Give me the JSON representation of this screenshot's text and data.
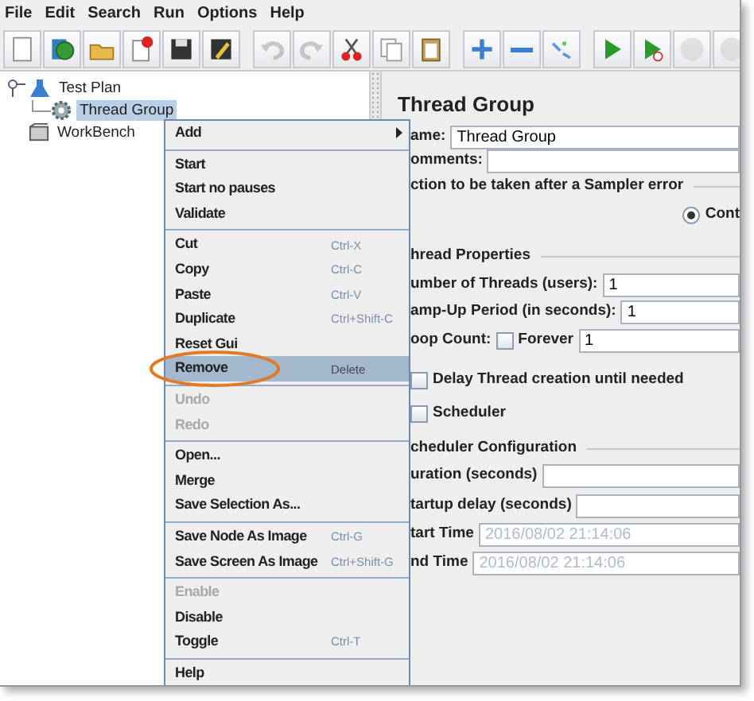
{
  "menu_bar": [
    {
      "label": "File"
    },
    {
      "label": "Edit"
    },
    {
      "label": "Search"
    },
    {
      "label": "Run"
    },
    {
      "label": "Options"
    },
    {
      "label": "Help"
    }
  ],
  "toolbar": [
    {
      "kind": "new",
      "disabled": false
    },
    {
      "kind": "templates",
      "disabled": false
    },
    {
      "kind": "open",
      "disabled": false
    },
    {
      "kind": "close",
      "disabled": false
    },
    {
      "kind": "save",
      "disabled": false
    },
    {
      "kind": "save_as",
      "disabled": false
    },
    {
      "kind": "separator"
    },
    {
      "kind": "undo",
      "disabled": true
    },
    {
      "kind": "redo",
      "disabled": true
    },
    {
      "kind": "cut",
      "disabled": false
    },
    {
      "kind": "copy",
      "disabled": false
    },
    {
      "kind": "paste",
      "disabled": false
    },
    {
      "kind": "separator"
    },
    {
      "kind": "expand",
      "disabled": false
    },
    {
      "kind": "collapse",
      "disabled": false
    },
    {
      "kind": "toggle",
      "disabled": false
    },
    {
      "kind": "separator"
    },
    {
      "kind": "start",
      "disabled": false
    },
    {
      "kind": "start_no_pauses",
      "disabled": false
    },
    {
      "kind": "stop",
      "disabled": true
    },
    {
      "kind": "shutdown",
      "disabled": true
    }
  ],
  "tree": [
    {
      "label": "Test Plan",
      "kind": "plan",
      "selected": false,
      "expanded": true,
      "children": [
        {
          "label": "Thread Group",
          "kind": "group",
          "selected": true
        }
      ]
    },
    {
      "label": "WorkBench",
      "kind": "bench",
      "selected": false
    }
  ],
  "form": {
    "title": "Thread Group",
    "name": {
      "label": "ame:",
      "value": "Thread Group"
    },
    "comments": {
      "label": "omments:"
    },
    "error_action": {
      "legend": "ction to be taken after a Sampler error",
      "option": {
        "label": "Cont",
        "selected": true
      }
    },
    "thread_properties": {
      "legend": "hread Properties",
      "threads": {
        "label": "umber of Threads (users):",
        "value": "1"
      },
      "ramp_up": {
        "label": "amp-Up Period (in seconds):",
        "value": "1"
      },
      "loop": {
        "label": "oop Count:",
        "forever": {
          "label": "Forever",
          "checked": false
        },
        "value": "1"
      }
    },
    "delay": {
      "label": "Delay Thread creation until needed",
      "checked": false
    },
    "scheduler": {
      "label": "Scheduler",
      "checked": false
    },
    "scheduler_config": {
      "legend": "cheduler Configuration",
      "duration": {
        "label": "uration (seconds)"
      },
      "startup": {
        "label": "tartup delay (seconds)"
      },
      "start_time": {
        "label": "tart Time",
        "value": "2016/08/02 21:14:06",
        "disabled": true
      },
      "end_time": {
        "label": "nd Time",
        "value": "2016/08/02 21:14:06",
        "disabled": true
      }
    }
  },
  "context_menu": [
    {
      "kind": "item",
      "label": "Add",
      "submenu": true,
      "disabled": false,
      "selected": false
    },
    {
      "kind": "separator"
    },
    {
      "kind": "item",
      "label": "Start",
      "disabled": false,
      "selected": false
    },
    {
      "kind": "item",
      "label": "Start no pauses",
      "disabled": false,
      "selected": false
    },
    {
      "kind": "item",
      "label": "Validate",
      "disabled": false,
      "selected": false
    },
    {
      "kind": "separator"
    },
    {
      "kind": "item",
      "label": "Cut",
      "shortcut": "Ctrl-X",
      "disabled": false,
      "selected": false
    },
    {
      "kind": "item",
      "label": "Copy",
      "shortcut": "Ctrl-C",
      "disabled": false,
      "selected": false
    },
    {
      "kind": "item",
      "label": "Paste",
      "shortcut": "Ctrl-V",
      "disabled": false,
      "selected": false
    },
    {
      "kind": "item",
      "label": "Duplicate",
      "shortcut": "Ctrl+Shift-C",
      "disabled": false,
      "selected": false
    },
    {
      "kind": "item",
      "label": "Reset Gui",
      "disabled": false,
      "selected": false
    },
    {
      "kind": "item",
      "label": "Remove",
      "shortcut": "Delete",
      "disabled": false,
      "selected": true,
      "highlighted": true
    },
    {
      "kind": "separator"
    },
    {
      "kind": "item",
      "label": "Undo",
      "disabled": true,
      "selected": false
    },
    {
      "kind": "item",
      "label": "Redo",
      "disabled": true,
      "selected": false
    },
    {
      "kind": "separator"
    },
    {
      "kind": "item",
      "label": "Open...",
      "disabled": false,
      "selected": false
    },
    {
      "kind": "item",
      "label": "Merge",
      "disabled": false,
      "selected": false
    },
    {
      "kind": "item",
      "label": "Save Selection As...",
      "disabled": false,
      "selected": false
    },
    {
      "kind": "separator"
    },
    {
      "kind": "item",
      "label": "Save Node As Image",
      "shortcut": "Ctrl-G",
      "disabled": false,
      "selected": false
    },
    {
      "kind": "item",
      "label": "Save Screen As Image",
      "shortcut": "Ctrl+Shift-G",
      "disabled": false,
      "selected": false
    },
    {
      "kind": "separator"
    },
    {
      "kind": "item",
      "label": "Enable",
      "disabled": true,
      "selected": false
    },
    {
      "kind": "item",
      "label": "Disable",
      "disabled": false,
      "selected": false
    },
    {
      "kind": "item",
      "label": "Toggle",
      "shortcut": "Ctrl-T",
      "disabled": false,
      "selected": false
    },
    {
      "kind": "separator"
    },
    {
      "kind": "item",
      "label": "Help",
      "disabled": false,
      "selected": false
    }
  ]
}
